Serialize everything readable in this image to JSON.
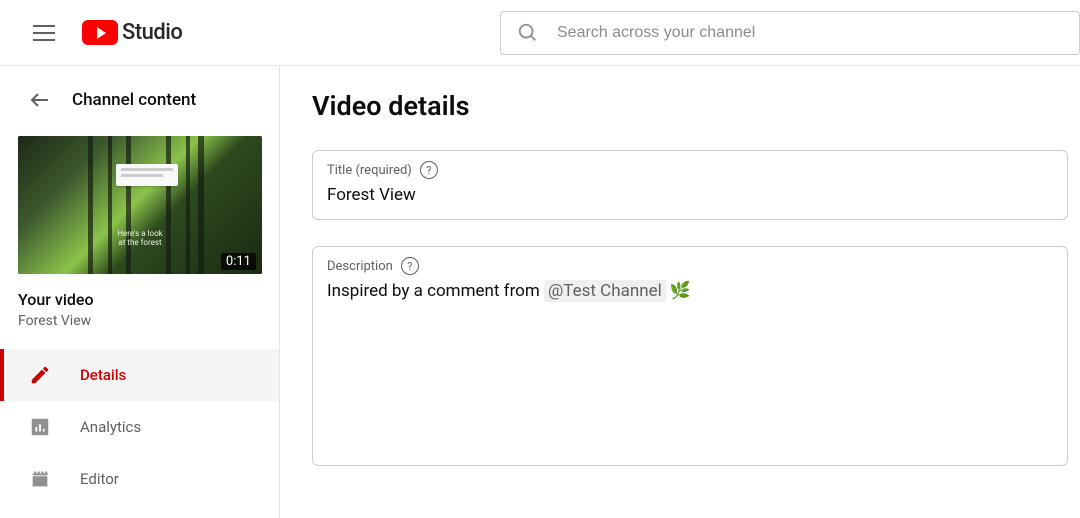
{
  "header": {
    "logo_text": "Studio",
    "search_placeholder": "Search across your channel"
  },
  "sidebar": {
    "back_label": "Channel content",
    "thumb": {
      "caption_line1": "Here's a look",
      "caption_line2": "at the forest",
      "duration": "0:11"
    },
    "your_video_label": "Your video",
    "video_name": "Forest View",
    "nav": [
      {
        "id": "details",
        "label": "Details",
        "icon": "pencil-icon",
        "active": true
      },
      {
        "id": "analytics",
        "label": "Analytics",
        "icon": "chart-icon",
        "active": false
      },
      {
        "id": "editor",
        "label": "Editor",
        "icon": "clapboard-icon",
        "active": false
      }
    ]
  },
  "main": {
    "page_title": "Video details",
    "title_field": {
      "label": "Title (required)",
      "value": "Forest View"
    },
    "description_field": {
      "label": "Description",
      "value_prefix": "Inspired by a comment from ",
      "mention": "@Test Channel",
      "emoji": "🌿"
    }
  }
}
